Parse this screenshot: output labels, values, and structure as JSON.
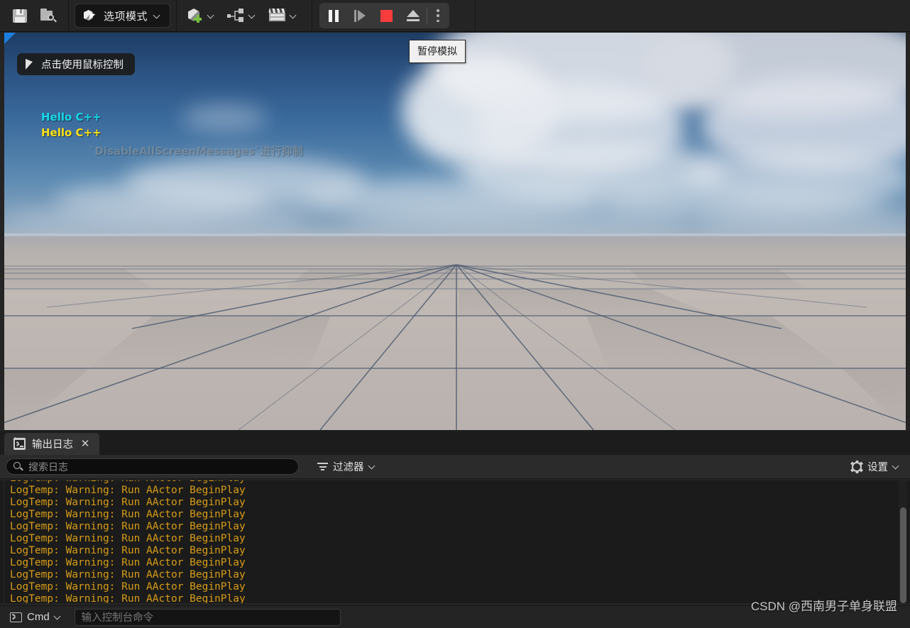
{
  "toolbar": {
    "save_icon": "save-icon",
    "browse_icon": "browse-content-icon",
    "mode_button": {
      "label": "选项模式",
      "icon": "select-mode-cube-cursor-icon"
    },
    "add_actor": {
      "icon": "add-actor-cube-plus-icon",
      "label": ""
    },
    "blueprints": {
      "icon": "blueprint-node-icon",
      "label": ""
    },
    "cinematics": {
      "icon": "cinematics-clapboard-icon",
      "label": ""
    },
    "play_controls": {
      "pause": {
        "icon": "pause-icon",
        "tooltip": "暂停模拟"
      },
      "frame_step": {
        "icon": "frame-step-icon"
      },
      "stop": {
        "icon": "stop-icon",
        "color": "#f63c3c"
      },
      "eject": {
        "icon": "eject-icon"
      },
      "more": {
        "icon": "kebab-menu-icon"
      }
    }
  },
  "tooltip": {
    "text": "暂停模拟"
  },
  "viewport": {
    "mouse_hint": {
      "label": "点击使用鼠标控制",
      "icon": "cursor-arrow-icon"
    },
    "screen_messages": [
      {
        "text": "Hello C++",
        "color": "#17d9e8"
      },
      {
        "text": "Hello C++",
        "color": "#fbe116"
      }
    ],
    "suppress_note": "`DisableAllScreenMessages`进行抑制"
  },
  "output_log": {
    "tab": {
      "label": "输出日志",
      "icon": "console-icon",
      "close_icon": "close-icon"
    },
    "search": {
      "placeholder": "搜索日志",
      "value": "",
      "icon": "search-icon"
    },
    "filter": {
      "label": "过滤器",
      "icon": "filter-icon"
    },
    "settings": {
      "label": "设置",
      "icon": "gear-icon"
    },
    "lines": [
      "LogTemp: Warning: Run AActor BeginPlay",
      "LogTemp: Warning: Run AActor BeginPlay",
      "LogTemp: Warning: Run AActor BeginPlay",
      "LogTemp: Warning: Run AActor BeginPlay",
      "LogTemp: Warning: Run AActor BeginPlay",
      "LogTemp: Warning: Run AActor BeginPlay",
      "LogTemp: Warning: Run AActor BeginPlay",
      "LogTemp: Warning: Run AActor BeginPlay",
      "LogTemp: Warning: Run AActor BeginPlay",
      "LogTemp: Warning: Run AActor BeginPlay",
      "LogTemp: Warning: Run AActor BeginPlay"
    ],
    "line_color": "#d79d17",
    "command_bar": {
      "selector_label": "Cmd",
      "selector_icon": "console-prompt-icon",
      "input_placeholder": "输入控制台命令",
      "input_value": ""
    }
  },
  "watermark": {
    "text": "CSDN @西南男子单身联盟"
  }
}
